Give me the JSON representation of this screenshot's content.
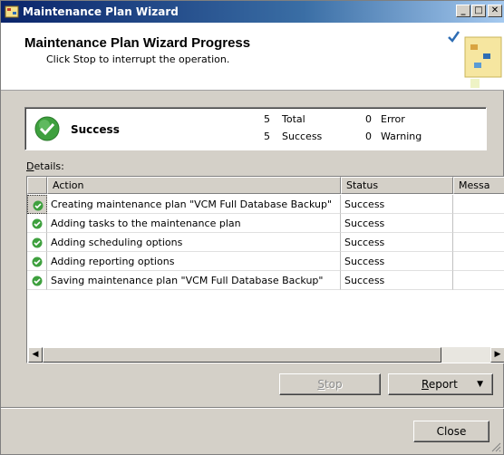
{
  "window": {
    "title": "Maintenance Plan Wizard"
  },
  "header": {
    "title": "Maintenance Plan Wizard Progress",
    "subtitle": "Click Stop to interrupt the operation."
  },
  "summary": {
    "status": "Success",
    "total_count": "5",
    "total_label": "Total",
    "success_count": "5",
    "success_label": "Success",
    "error_count": "0",
    "error_label": "Error",
    "warning_count": "0",
    "warning_label": "Warning"
  },
  "details": {
    "label_accel": "D",
    "label_rest": "etails:",
    "columns": [
      "Action",
      "Status",
      "Messa"
    ],
    "rows": [
      {
        "action": "Creating maintenance plan \"VCM Full Database Backup\"",
        "status": "Success",
        "message": ""
      },
      {
        "action": "Adding tasks to the maintenance plan",
        "status": "Success",
        "message": ""
      },
      {
        "action": "Adding scheduling options",
        "status": "Success",
        "message": ""
      },
      {
        "action": "Adding reporting options",
        "status": "Success",
        "message": ""
      },
      {
        "action": "Saving maintenance plan \"VCM Full Database Backup\"",
        "status": "Success",
        "message": ""
      }
    ]
  },
  "buttons": {
    "stop_accel": "S",
    "stop_rest": "top",
    "report_accel": "R",
    "report_rest": "eport",
    "close": "Close"
  },
  "colors": {
    "success_green": "#3ea03e",
    "title_bar": "#0a246a"
  }
}
